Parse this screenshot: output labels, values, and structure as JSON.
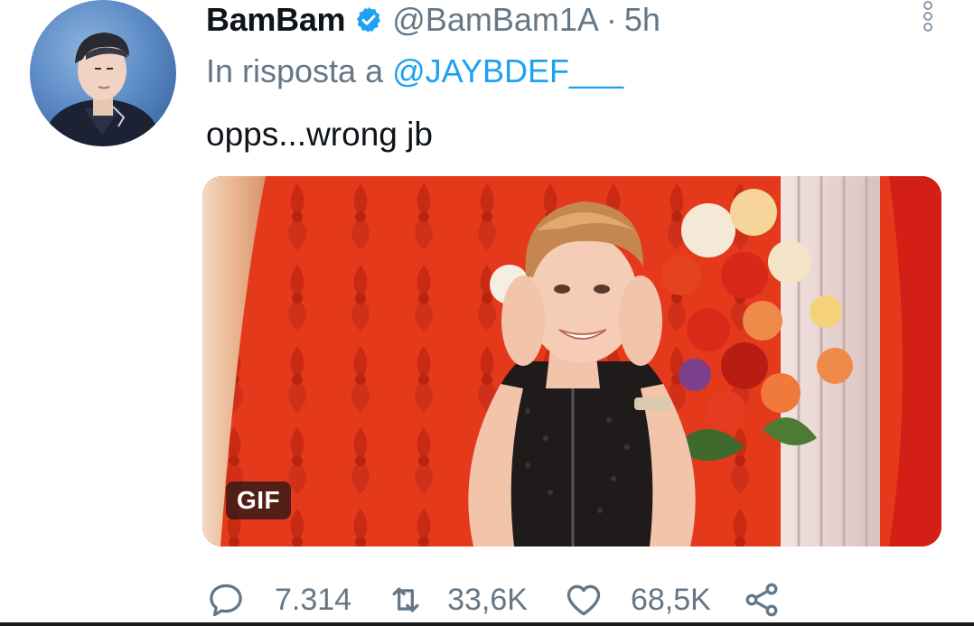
{
  "tweet": {
    "display_name": "BamBam",
    "handle": "@BamBam1A",
    "separator": "·",
    "time": "5h",
    "reply_prefix": "In risposta a",
    "reply_to": "@JAYBDEF___",
    "text": "opps...wrong jb",
    "media_badge": "GIF"
  },
  "actions": {
    "replies": "7.314",
    "retweets": "33,6K",
    "likes": "68,5K"
  },
  "icons": {
    "verified": "verified-badge-icon",
    "more": "more-vertical-icon",
    "reply": "reply-bubble-icon",
    "retweet": "retweet-icon",
    "like": "heart-icon",
    "share": "share-icon"
  },
  "colors": {
    "text": "#0f1419",
    "secondary": "#657786",
    "accent": "#1da1f2",
    "media_background": "#e63b1f"
  }
}
